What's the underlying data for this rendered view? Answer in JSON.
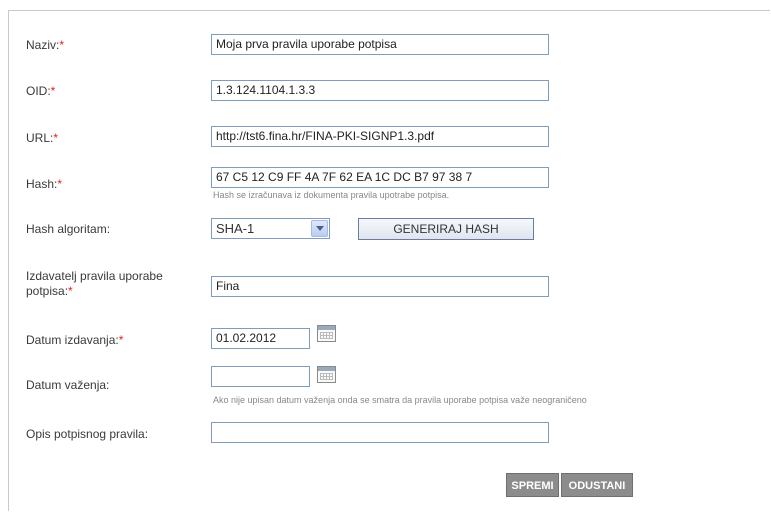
{
  "form": {
    "naziv": {
      "label": "Naziv:",
      "req": "*",
      "value": "Moja prva pravila uporabe potpisa"
    },
    "oid": {
      "label": "OID:",
      "req": "*",
      "value": "1.3.124.1104.1.3.3"
    },
    "url": {
      "label": "URL:",
      "req": "*",
      "value": "http://tst6.fina.hr/FINA-PKI-SIGNP1.3.pdf"
    },
    "hash": {
      "label": "Hash:",
      "req": "*",
      "value": "67 C5 12 C9 FF 4A 7F 62 EA 1C DC B7 97 38 7",
      "hint": "Hash se izračunava iz dokumenta pravila upotrabe potpisa."
    },
    "hash_algoritam": {
      "label": "Hash algoritam:",
      "selected": "SHA-1",
      "generate_label": "GENERIRAJ HASH"
    },
    "izdavatelj": {
      "label_line1": "Izdavatelj pravila uporabe",
      "label_line2": "potpisa:",
      "req": "*",
      "value": "Fina"
    },
    "datum_izdavanja": {
      "label": "Datum izdavanja:",
      "req": "*",
      "value": "01.02.2012"
    },
    "datum_vazenja": {
      "label": "Datum važenja:",
      "value": "",
      "hint": "Ako nije upisan datum važenja onda se smatra da pravila uporabe potpisa važe neograničeno"
    },
    "opis": {
      "label": "Opis potpisnog pravila:",
      "value": ""
    }
  },
  "actions": {
    "save_label": "SPREMI",
    "cancel_label": "ODUSTANI"
  },
  "colors": {
    "required": "#e02020",
    "input_border": "#7f9db9",
    "button_gray": "#8c8c8c"
  }
}
